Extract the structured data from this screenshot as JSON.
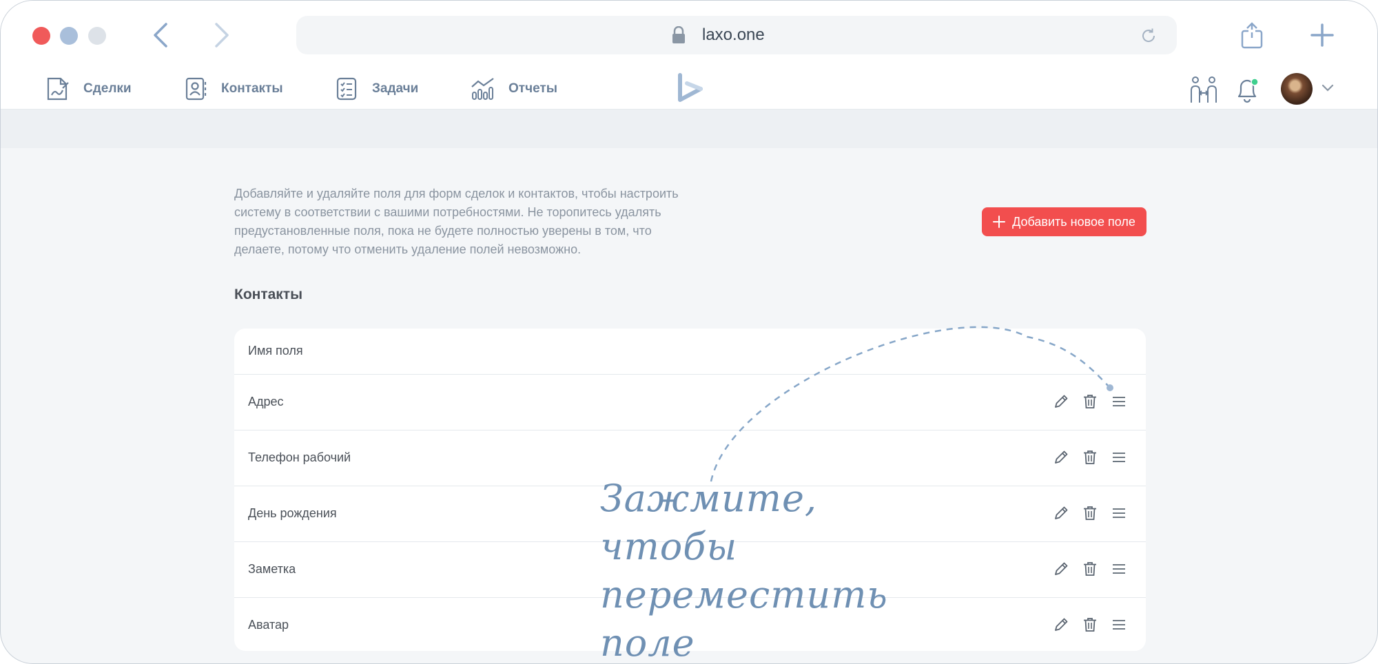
{
  "browser": {
    "url": "laxo.one"
  },
  "nav": {
    "items": [
      {
        "label": "Сделки",
        "icon": "deals-icon"
      },
      {
        "label": "Контакты",
        "icon": "contacts-icon"
      },
      {
        "label": "Задачи",
        "icon": "tasks-icon"
      },
      {
        "label": "Отчеты",
        "icon": "reports-icon"
      }
    ]
  },
  "page": {
    "description": "Добавляйте и удаляйте поля для форм сделок и контактов, чтобы настроить систему в соответствии с вашими потребностями. Не торопитесь удалять предустановленные поля, пока не будете полностью уверены в том, что делаете, потому что отменить удаление полей невозможно.",
    "add_button_label": "Добавить новое поле",
    "section_title": "Контакты",
    "table": {
      "header": "Имя поля",
      "rows": [
        "Адрес",
        "Телефон рабочий",
        "День рождения",
        "Заметка",
        "Аватар"
      ]
    },
    "hint": {
      "line1": "Зажмите, чтобы",
      "line2": "переместить поле"
    }
  },
  "colors": {
    "accent": "#f24e4e",
    "nav_text": "#6a7f98",
    "hint": "#6f90b3"
  }
}
